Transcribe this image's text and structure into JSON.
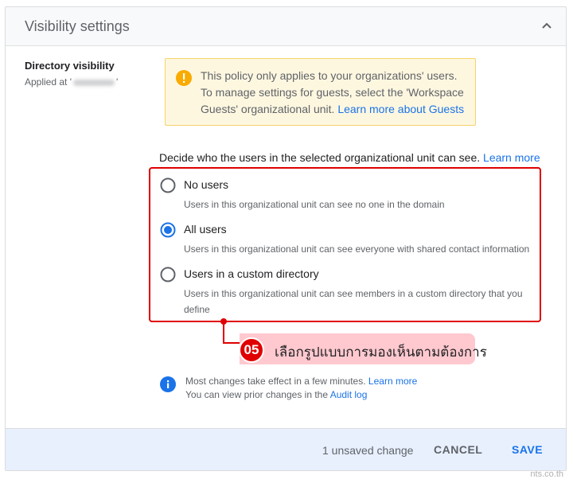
{
  "header": {
    "title": "Visibility settings",
    "collapse_icon": "chevron-up-icon"
  },
  "sidebar": {
    "title": "Directory visibility",
    "applied_prefix": "Applied at '",
    "applied_suffix": "'"
  },
  "notice": {
    "text": "This policy only applies to your organizations' users. To manage settings for guests, select the 'Workspace Guests' organizational unit.",
    "link": "Learn more about Guests",
    "icon": "warning-icon",
    "color": "#f9ab00"
  },
  "prompt": {
    "text": "Decide who the users in the selected organizational unit can see.",
    "link": "Learn more"
  },
  "options": [
    {
      "label": "No users",
      "description": "Users in this organizational unit can see no one in the domain",
      "selected": false
    },
    {
      "label": "All users",
      "description": "Users in this organizational unit can see everyone with shared contact information",
      "selected": true
    },
    {
      "label": "Users in a custom directory",
      "description": "Users in this organizational unit can see members in a custom directory that you define",
      "selected": false
    }
  ],
  "callout": {
    "number": "05",
    "text": "เลือกรูปแบบการมองเห็นตามต้องการ",
    "color": "#e00000"
  },
  "info": {
    "line1": "Most changes take effect in a few minutes.",
    "line1_link": "Learn more",
    "line2": "You can view prior changes in the",
    "line2_link": "Audit log",
    "icon": "info-icon"
  },
  "footer": {
    "unsaved": "1 unsaved change",
    "cancel": "CANCEL",
    "save": "SAVE"
  },
  "watermark": "nts.co.th",
  "colors": {
    "accent": "#1a73e8",
    "highlight": "#e00000"
  }
}
